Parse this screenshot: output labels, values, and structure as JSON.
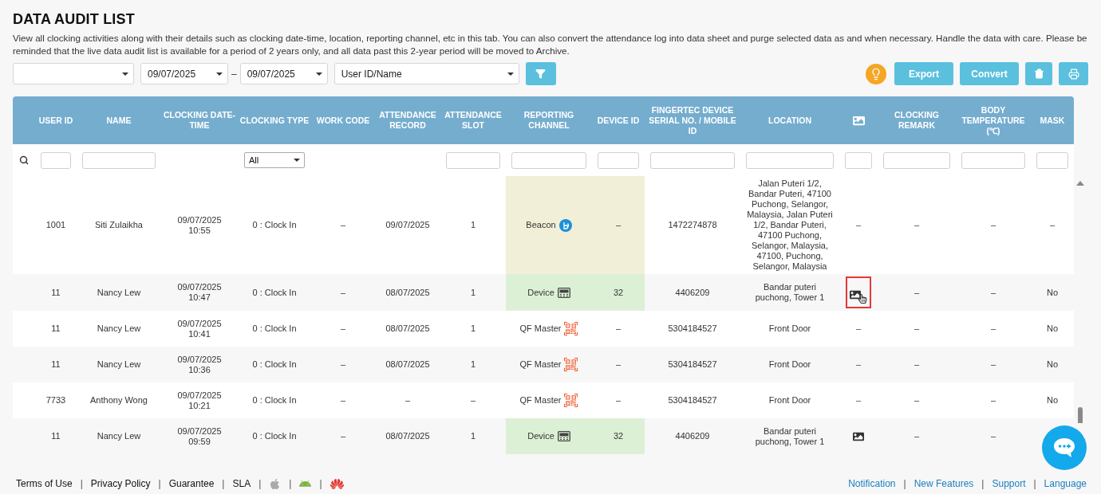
{
  "page": {
    "title": "DATA AUDIT LIST",
    "description": "View all clocking activities along with their details such as clocking date-time, location, reporting channel, etc in this tab. You can also convert the attendance log into data sheet and purge selected data as and when necessary. Handle the data with care. Please be reminded that the live data audit list is available for a period of 2 years only, and all data past this 2-year period will be moved to Archive."
  },
  "toolbar": {
    "date_from": "09/07/2025",
    "date_separator": "–",
    "date_to": "09/07/2025",
    "user_filter": "User ID/Name",
    "actions": [
      {
        "kind": "tip"
      },
      {
        "kind": "text",
        "label": "Export"
      },
      {
        "kind": "text",
        "label": "Convert"
      },
      {
        "kind": "delete"
      },
      {
        "kind": "print"
      }
    ]
  },
  "table": {
    "columns": [
      {
        "kind": "text",
        "label": "USER ID",
        "filter": {
          "kind": "input"
        }
      },
      {
        "kind": "text",
        "label": "NAME",
        "filter": {
          "kind": "input"
        }
      },
      {
        "kind": "text",
        "label": "CLOCKING DATE-TIME"
      },
      {
        "kind": "text",
        "label": "CLOCKING TYPE",
        "filter": {
          "kind": "select",
          "value": "All"
        }
      },
      {
        "kind": "text",
        "label": "WORK CODE"
      },
      {
        "kind": "text",
        "label": "ATTENDANCE RECORD"
      },
      {
        "kind": "text",
        "label": "ATTENDANCE SLOT",
        "filter": {
          "kind": "input"
        }
      },
      {
        "kind": "text",
        "label": "REPORTING CHANNEL",
        "filter": {
          "kind": "input"
        }
      },
      {
        "kind": "text",
        "label": "DEVICE ID",
        "filter": {
          "kind": "input"
        }
      },
      {
        "kind": "text",
        "label": "FINGERTEC DEVICE SERIAL NO. / MOBILE ID",
        "filter": {
          "kind": "input"
        }
      },
      {
        "kind": "text",
        "label": "LOCATION",
        "filter": {
          "kind": "input"
        }
      },
      {
        "kind": "icon",
        "filter": {
          "kind": "input"
        }
      },
      {
        "kind": "text",
        "label": "CLOCKING REMARK",
        "filter": {
          "kind": "input"
        }
      },
      {
        "kind": "text",
        "label": "BODY TEMPERATURE (℃)",
        "filter": {
          "kind": "input"
        }
      },
      {
        "kind": "text",
        "label": "MASK",
        "filter": {
          "kind": "input"
        }
      }
    ],
    "rows": [
      {
        "user_id": "1001",
        "name": "Siti Zulaikha",
        "date_time": "09/07/2025\n10:55",
        "clocking_type": "0 : Clock In",
        "work_code": "–",
        "attendance_record": "09/07/2025",
        "attendance_slot": "1",
        "channel": {
          "kind": "beacon",
          "label": "Beacon"
        },
        "device_id": "–",
        "serial": "1472274878",
        "location": "Jalan Puteri 1/2, Bandar Puteri, 47100 Puchong, Selangor, Malaysia, Jalan Puteri 1/2, Bandar Puteri, 47100 Puchong, Selangor, Malaysia, 47100, Puchong, Selangor, Malaysia",
        "image_text": "–",
        "remark": "–",
        "temperature": "–",
        "mask": "–"
      },
      {
        "user_id": "11",
        "name": "Nancy Lew",
        "date_time": "09/07/2025\n10:47",
        "clocking_type": "0 : Clock In",
        "work_code": "–",
        "attendance_record": "08/07/2025",
        "attendance_slot": "1",
        "channel": {
          "kind": "device",
          "label": "Device"
        },
        "device_id": "32",
        "serial": "4406209",
        "location": "Bandar puteri puchong, Tower 1",
        "photo": {
          "highlighted": true
        },
        "remark": "–",
        "temperature": "–",
        "mask": "No"
      },
      {
        "user_id": "11",
        "name": "Nancy Lew",
        "date_time": "09/07/2025\n10:41",
        "clocking_type": "0 : Clock In",
        "work_code": "–",
        "attendance_record": "08/07/2025",
        "attendance_slot": "1",
        "channel": {
          "kind": "qr",
          "label": "QF Master"
        },
        "device_id": "–",
        "serial": "5304184527",
        "location": "Front Door",
        "image_text": "–",
        "remark": "–",
        "temperature": "–",
        "mask": "No"
      },
      {
        "user_id": "11",
        "name": "Nancy Lew",
        "date_time": "09/07/2025\n10:36",
        "clocking_type": "0 : Clock In",
        "work_code": "–",
        "attendance_record": "08/07/2025",
        "attendance_slot": "1",
        "channel": {
          "kind": "qr",
          "label": "QF Master"
        },
        "device_id": "–",
        "serial": "5304184527",
        "location": "Front Door",
        "image_text": "–",
        "remark": "–",
        "temperature": "–",
        "mask": "No"
      },
      {
        "user_id": "7733",
        "name": "Anthony Wong",
        "date_time": "09/07/2025\n10:21",
        "clocking_type": "0 : Clock In",
        "work_code": "–",
        "attendance_record": "–",
        "attendance_slot": "–",
        "channel": {
          "kind": "qr",
          "label": "QF Master"
        },
        "device_id": "–",
        "serial": "5304184527",
        "location": "Front Door",
        "image_text": "–",
        "remark": "–",
        "temperature": "–",
        "mask": "No"
      },
      {
        "user_id": "11",
        "name": "Nancy Lew",
        "date_time": "09/07/2025\n09:59",
        "clocking_type": "0 : Clock In",
        "work_code": "–",
        "attendance_record": "08/07/2025",
        "attendance_slot": "1",
        "channel": {
          "kind": "device",
          "label": "Device"
        },
        "device_id": "32",
        "serial": "4406209",
        "location": "Bandar puteri puchong, Tower 1",
        "photo": {
          "highlighted": false
        },
        "remark": "–",
        "temperature": "–"
      }
    ]
  },
  "footer": {
    "left": [
      {
        "kind": "link",
        "label": "Terms of Use"
      },
      {
        "kind": "separator",
        "label": "|"
      },
      {
        "kind": "link",
        "label": "Privacy Policy"
      },
      {
        "kind": "separator",
        "label": "|"
      },
      {
        "kind": "link",
        "label": "Guarantee"
      },
      {
        "kind": "separator",
        "label": "|"
      },
      {
        "kind": "link",
        "label": "SLA"
      },
      {
        "kind": "separator",
        "label": "|"
      },
      {
        "kind": "apple"
      },
      {
        "kind": "separator",
        "label": "|"
      },
      {
        "kind": "android"
      },
      {
        "kind": "separator",
        "label": "|"
      },
      {
        "kind": "huawei"
      }
    ],
    "right": [
      {
        "kind": "link",
        "label": "Notification"
      },
      {
        "kind": "separator",
        "label": "|"
      },
      {
        "kind": "link",
        "label": "New Features"
      },
      {
        "kind": "separator",
        "label": "|"
      },
      {
        "kind": "link",
        "label": "Support"
      },
      {
        "kind": "separator",
        "label": "|"
      },
      {
        "kind": "link",
        "label": "Language"
      }
    ]
  }
}
